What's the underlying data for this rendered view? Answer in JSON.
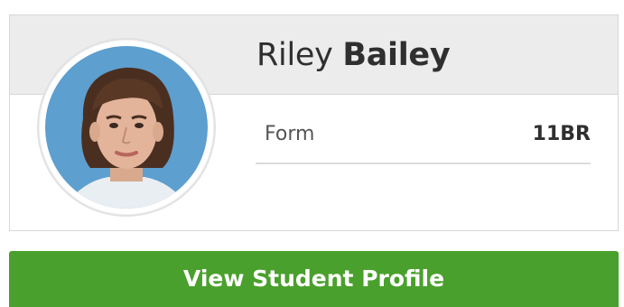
{
  "student": {
    "first_name": "Riley",
    "last_name": "Bailey"
  },
  "details": [
    {
      "label": "Form",
      "value": "11BR"
    }
  ],
  "actions": {
    "view_profile_label": "View Student Profile"
  },
  "colors": {
    "header_bg": "#ececec",
    "button_bg": "#4aa02c",
    "photo_bg": "#5d9fcf"
  }
}
